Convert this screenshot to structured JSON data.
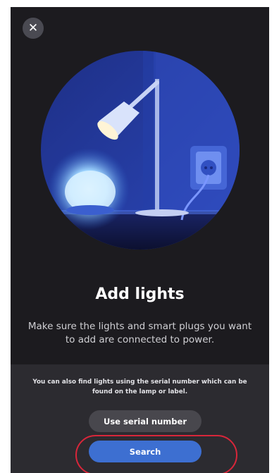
{
  "header": {
    "close_icon": "close-icon",
    "close_glyph": "✕"
  },
  "illustration": {
    "subject": "lamp-illustration",
    "colors": {
      "background": "#1a2f7a",
      "wall": "#2a3fa8",
      "lamp_glow": "#bfe6ff",
      "outlet": "#3a5ccc"
    }
  },
  "main": {
    "title": "Add lights",
    "subtitle": "Make sure the lights and smart plugs you want to add are connected to power."
  },
  "footer": {
    "hint": "You can also find lights using the serial number which can be found on the lamp or label.",
    "serial_button_label": "Use serial number",
    "search_button_label": "Search"
  },
  "colors": {
    "background": "#1c1b1f",
    "panel": "#2c2b30",
    "primary_button": "#3d6fd1",
    "secondary_button": "#48474d",
    "highlight": "#d8263a"
  }
}
